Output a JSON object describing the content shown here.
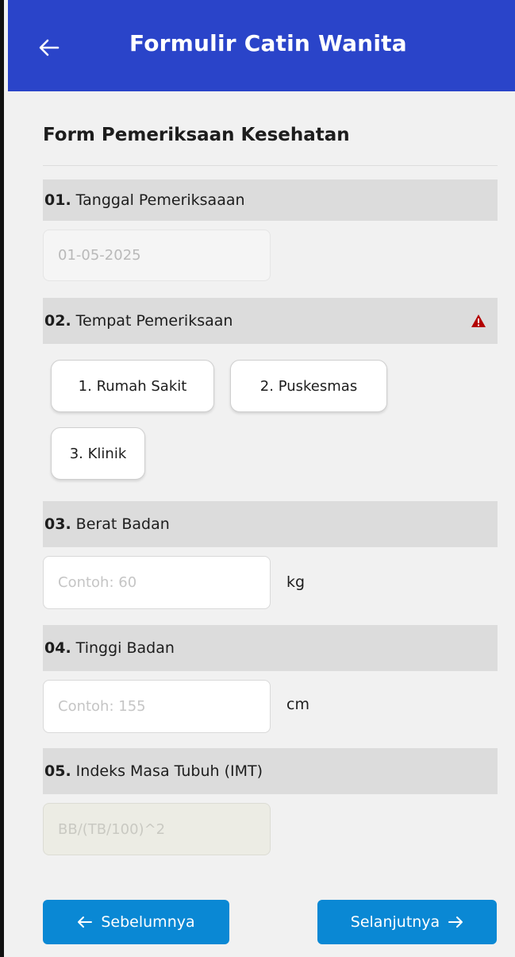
{
  "appbar": {
    "title": "Formulir Catin Wanita",
    "back_icon": "arrow-left-icon",
    "color": "#2a44c9"
  },
  "section": {
    "title": "Form Pemeriksaan Kesehatan"
  },
  "questions": [
    {
      "num": "01.",
      "label": "Tanggal Pemeriksaaan",
      "placeholder": "01-05-2025"
    },
    {
      "num": "02.",
      "label": "Tempat Pemeriksaan",
      "warning_icon": "warning-triangle-icon",
      "warning_color": "#b30000",
      "options": [
        "1. Rumah Sakit",
        "2. Puskesmas",
        "3. Klinik"
      ]
    },
    {
      "num": "03.",
      "label": "Berat Badan",
      "placeholder": "Contoh: 60",
      "unit": "kg"
    },
    {
      "num": "04.",
      "label": "Tinggi Badan",
      "placeholder": "Contoh: 155",
      "unit": "cm"
    },
    {
      "num": "05.",
      "label": "Indeks Masa Tubuh (IMT)",
      "placeholder": "BB/(TB/100)^2"
    }
  ],
  "nav": {
    "prev_label": "Sebelumnya",
    "next_label": "Selanjutnya",
    "prev_icon": "arrow-left-icon",
    "next_icon": "arrow-right-icon",
    "color": "#0a88d4"
  }
}
